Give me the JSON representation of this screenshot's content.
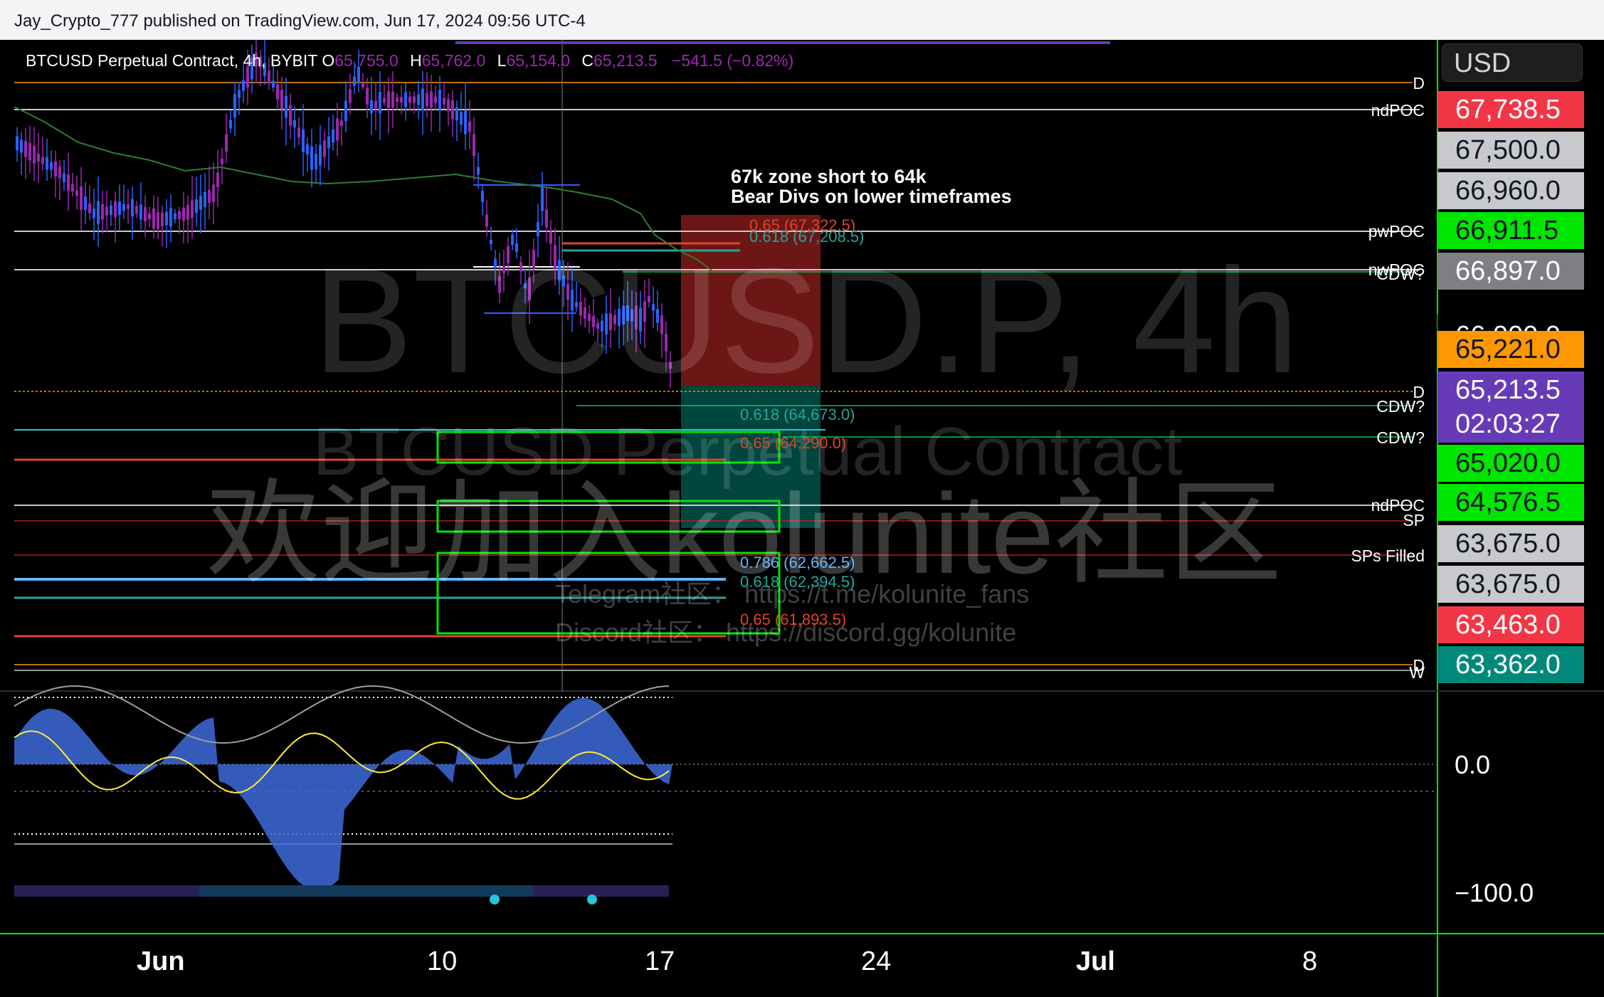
{
  "publish_bar": "Jay_Crypto_777 published on TradingView.com, Jun 17, 2024 09:56 UTC-4",
  "legend": {
    "symbol": "BTCUSD Perpetual Contract, 4h, BYBIT",
    "o_label": "O",
    "o_value": "65,755.0",
    "h_label": "H",
    "h_value": "65,762.0",
    "l_label": "L",
    "l_value": "65,154.0",
    "c_label": "C",
    "c_value": "65,213.5",
    "change": "−541.5 (−0.82%)"
  },
  "currency": "USD",
  "watermark": {
    "big": "BTCUSD.P, 4h",
    "sub": "BTCUSD Perpetual Contract",
    "chinese": "欢迎加入kolunite社区",
    "telegram": "Telegram社区： https://t.me/kolunite_fans",
    "discord": "Discord社区： https://discord.gg/kolunite"
  },
  "note": {
    "line1": "67k zone short to 64k",
    "line2": "Bear Divs on lower timeframes"
  },
  "fib_labels": [
    {
      "text": "0.65 (67,322.5)",
      "color": "#e0442a"
    },
    {
      "text": "0.618 (67,208.5)",
      "color": "#26a69a"
    },
    {
      "text": "0.618 (64,673.0)",
      "color": "#26a69a"
    },
    {
      "text": "0.65 (64,290.0)",
      "color": "#e0442a"
    },
    {
      "text": "0.786 (62,662.5)",
      "color": "#64b5f6"
    },
    {
      "text": "0.618 (62,394.5)",
      "color": "#26a69a"
    },
    {
      "text": "0.65 (61,893.5)",
      "color": "#e0442a"
    }
  ],
  "level_labels": [
    "D",
    "ndPOC",
    "pwPOC",
    "nwPOC",
    "CDW?",
    "D",
    "CDW?",
    "CDW?",
    "ndPOC",
    "SP",
    "SPs Filled",
    "D",
    "W"
  ],
  "price_axis": [
    {
      "value": "67,738.5",
      "bg": "#f23645",
      "fg": "#ffffff"
    },
    {
      "value": "67,500.0",
      "bg": "#c8c9cd",
      "fg": "#131722"
    },
    {
      "value": "66,960.0",
      "bg": "#c8c9cd",
      "fg": "#131722"
    },
    {
      "value": "66,911.5",
      "bg": "#00e600",
      "fg": "#131722"
    },
    {
      "value": "66,897.0",
      "bg": "#7e7f83",
      "fg": "#ffffff"
    },
    {
      "value": "66,000.0",
      "bg": "#000000",
      "fg": "#ffffff"
    },
    {
      "value": "65,221.0",
      "bg": "#ff9800",
      "fg": "#131722"
    },
    {
      "value": "65,213.5",
      "bg": "#673ab7",
      "fg": "#ffffff"
    },
    {
      "value": "02:03:27",
      "bg": "#673ab7",
      "fg": "#ffffff"
    },
    {
      "value": "65,020.0",
      "bg": "#00e600",
      "fg": "#131722"
    },
    {
      "value": "64,576.5",
      "bg": "#00e600",
      "fg": "#131722"
    },
    {
      "value": "63,675.0",
      "bg": "#c8c9cd",
      "fg": "#131722"
    },
    {
      "value": "63,675.0",
      "bg": "#c8c9cd",
      "fg": "#131722"
    },
    {
      "value": "63,463.0",
      "bg": "#f23645",
      "fg": "#ffffff"
    },
    {
      "value": "63,362.0",
      "bg": "#00897b",
      "fg": "#ffffff"
    }
  ],
  "oscillator_axis": [
    "0.0",
    "−100.0"
  ],
  "time_axis": [
    "Jun",
    "10",
    "17",
    "24",
    "Jul",
    "8"
  ],
  "colors": {
    "up": "#2962ff",
    "down": "#9c27b0",
    "zone_box": "#00e600",
    "short_red": "#c62828",
    "short_green": "#00897b"
  }
}
